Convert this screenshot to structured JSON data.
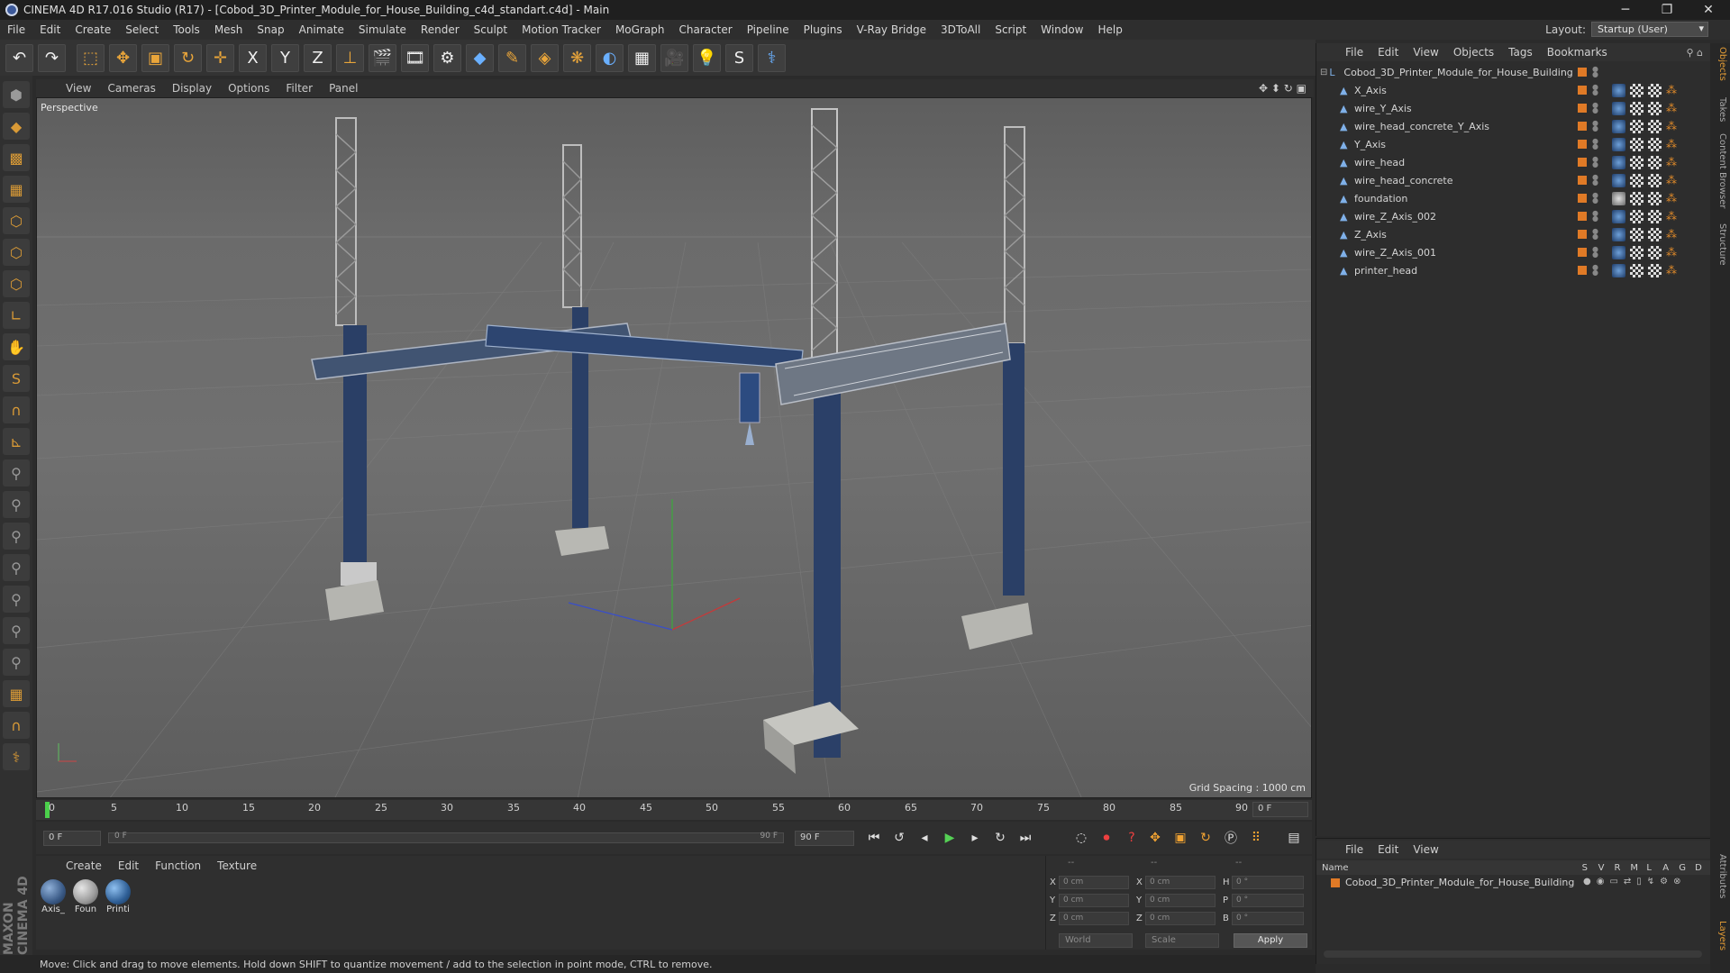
{
  "window": {
    "title": "CINEMA 4D R17.016 Studio (R17) - [Cobod_3D_Printer_Module_for_House_Building_c4d_standart.c4d] - Main",
    "controls": [
      "─",
      "❐",
      "✕"
    ]
  },
  "menubar": {
    "items": [
      "File",
      "Edit",
      "Create",
      "Select",
      "Tools",
      "Mesh",
      "Snap",
      "Animate",
      "Simulate",
      "Render",
      "Sculpt",
      "Motion Tracker",
      "MoGraph",
      "Character",
      "Pipeline",
      "Plugins",
      "V-Ray Bridge",
      "3DToAll",
      "Script",
      "Window",
      "Help"
    ],
    "layout_label": "Layout:",
    "layout_value": "Startup (User)"
  },
  "toolbar": {
    "icons": [
      "undo-icon",
      "redo-icon",
      "live-selection-icon",
      "move-icon",
      "scale-icon",
      "rotate-icon",
      "transform-icon",
      "x-axis-icon",
      "y-axis-icon",
      "z-axis-icon",
      "coordinate-system-icon",
      "render-view-icon",
      "render-picture-viewer-icon",
      "edit-render-settings-icon",
      "cube-icon",
      "pen-icon",
      "subdivision-icon",
      "cloner-icon",
      "deformer-icon",
      "floor-icon",
      "camera-icon",
      "light-icon",
      "python-icon",
      "script-icon"
    ],
    "axis_labels": [
      "X",
      "Y",
      "Z"
    ]
  },
  "viewport": {
    "menu": [
      "View",
      "Cameras",
      "Display",
      "Options",
      "Filter",
      "Panel"
    ],
    "label": "Perspective",
    "grid_spacing": "Grid Spacing : 1000 cm"
  },
  "timeline": {
    "ticks": [
      "0",
      "5",
      "10",
      "15",
      "20",
      "25",
      "30",
      "35",
      "40",
      "45",
      "50",
      "55",
      "60",
      "65",
      "70",
      "75",
      "80",
      "85",
      "90"
    ],
    "frame_field": "0 F",
    "start_field": "0 F",
    "slider_left": "0 F",
    "slider_right": "90 F",
    "end_field": "90 F"
  },
  "materials": {
    "menu": [
      "Create",
      "Edit",
      "Function",
      "Texture"
    ],
    "items": [
      {
        "label": "Axis_",
        "color": "#3a5a86"
      },
      {
        "label": "Foun",
        "color": "#9a9a9a"
      },
      {
        "label": "Printi",
        "color": "#2f5f96"
      }
    ]
  },
  "coordinates": {
    "header_left": "--",
    "header_mid": "--",
    "header_right": "--",
    "rows": [
      {
        "axis": "X",
        "pos": "0 cm",
        "axis2": "X",
        "size": "0 cm",
        "axis3": "H",
        "rot": "0 °"
      },
      {
        "axis": "Y",
        "pos": "0 cm",
        "axis2": "Y",
        "size": "0 cm",
        "axis3": "P",
        "rot": "0 °"
      },
      {
        "axis": "Z",
        "pos": "0 cm",
        "axis2": "Z",
        "size": "0 cm",
        "axis3": "B",
        "rot": "0 °"
      }
    ],
    "space": "World",
    "mode": "Scale",
    "apply": "Apply"
  },
  "status": {
    "text": "Move: Click and drag to move elements. Hold down SHIFT to quantize movement / add to the selection in point mode, CTRL to remove."
  },
  "object_manager": {
    "menu": [
      "File",
      "Edit",
      "View",
      "Objects",
      "Tags",
      "Bookmarks"
    ],
    "root": "Cobod_3D_Printer_Module_for_House_Building",
    "children": [
      "X_Axis",
      "wire_Y_Axis",
      "wire_head_concrete_Y_Axis",
      "Y_Axis",
      "wire_head",
      "wire_head_concrete",
      "foundation",
      "wire_Z_Axis_002",
      "Z_Axis",
      "wire_Z_Axis_001",
      "printer_head"
    ]
  },
  "layer_manager": {
    "menu": [
      "File",
      "Edit",
      "View"
    ],
    "columns": [
      "Name",
      "S",
      "V",
      "R",
      "M",
      "L",
      "A",
      "G",
      "D"
    ],
    "row": "Cobod_3D_Printer_Module_for_House_Building"
  },
  "right_tabs": [
    "Objects",
    "Takes",
    "Content Browser",
    "Structure",
    "Attributes",
    "Layers"
  ],
  "logo": "MAXON CINEMA 4D"
}
